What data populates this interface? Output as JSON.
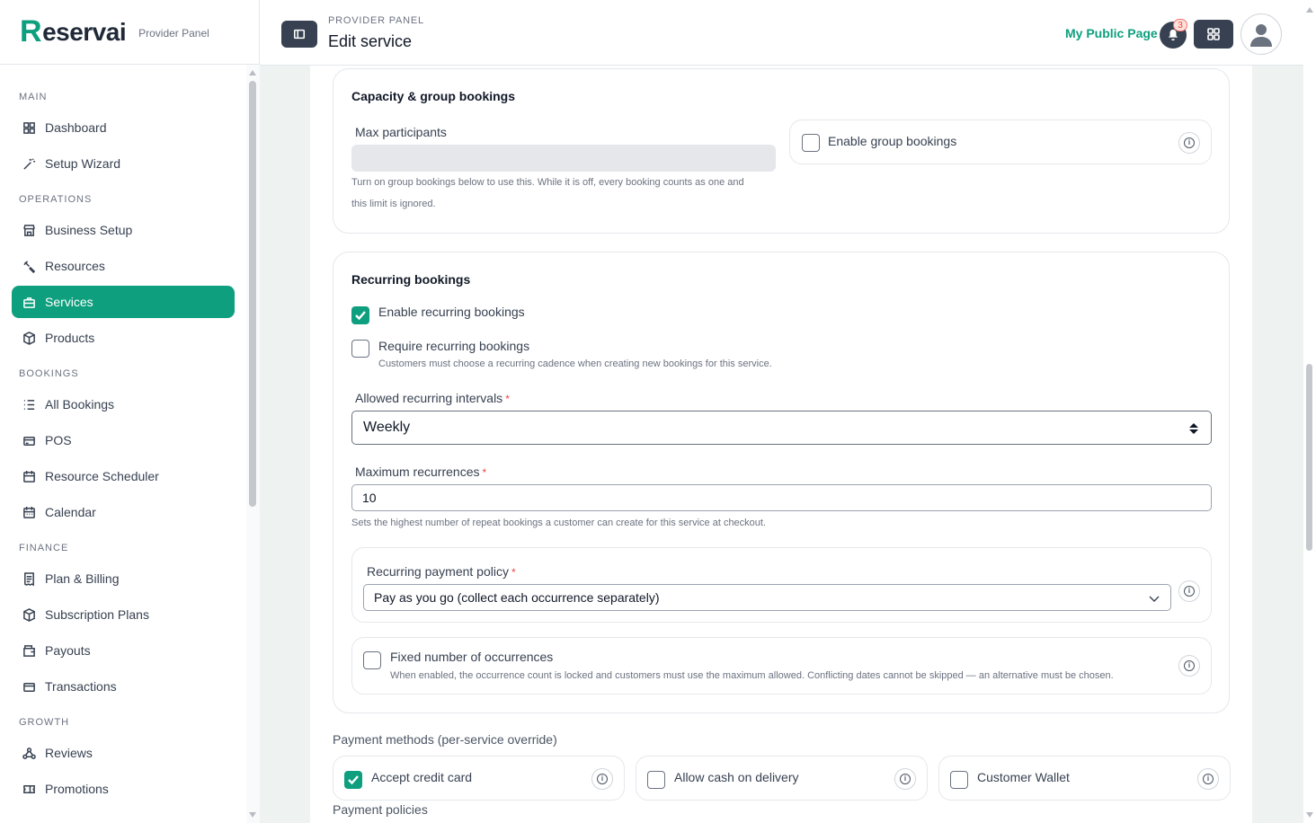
{
  "brand": {
    "name": "eservai",
    "initial": "R",
    "subtitle": "Provider Panel"
  },
  "sidebar": {
    "sections": [
      {
        "title": "MAIN",
        "items": [
          {
            "label": "Dashboard",
            "icon": "grid-icon"
          },
          {
            "label": "Setup Wizard",
            "icon": "wand-icon"
          }
        ]
      },
      {
        "title": "OPERATIONS",
        "items": [
          {
            "label": "Business Setup",
            "icon": "store-icon"
          },
          {
            "label": "Resources",
            "icon": "tools-icon"
          },
          {
            "label": "Services",
            "icon": "briefcase-icon",
            "active": true
          },
          {
            "label": "Products",
            "icon": "box-icon"
          }
        ]
      },
      {
        "title": "BOOKINGS",
        "items": [
          {
            "label": "All Bookings",
            "icon": "list-icon"
          },
          {
            "label": "POS",
            "icon": "card-icon"
          },
          {
            "label": "Resource Scheduler",
            "icon": "calendar-icon"
          },
          {
            "label": "Calendar",
            "icon": "calendar-icon"
          }
        ]
      },
      {
        "title": "FINANCE",
        "items": [
          {
            "label": "Plan & Billing",
            "icon": "receipt-icon"
          },
          {
            "label": "Subscription Plans",
            "icon": "box-icon"
          },
          {
            "label": "Payouts",
            "icon": "wallet-icon"
          },
          {
            "label": "Transactions",
            "icon": "card-icon"
          }
        ]
      },
      {
        "title": "GROWTH",
        "items": [
          {
            "label": "Reviews",
            "icon": "nodes-icon"
          },
          {
            "label": "Promotions",
            "icon": "ticket-icon"
          }
        ]
      }
    ]
  },
  "header": {
    "breadcrumb": "PROVIDER PANEL",
    "title": "Edit service",
    "public_page": "My Public Page",
    "notification_count": "3"
  },
  "capacity": {
    "title": "Capacity & group bookings",
    "max_label": "Max participants",
    "max_value": "",
    "max_help_1": "Turn on group bookings below to use this. While it is off, every booking counts as one and",
    "max_help_2": "this limit is ignored.",
    "group_label": "Enable group bookings",
    "group_checked": false
  },
  "recurring": {
    "title": "Recurring bookings",
    "enable_label": "Enable recurring bookings",
    "enable_checked": true,
    "require_label": "Require recurring bookings",
    "require_checked": false,
    "require_help": "Customers must choose a recurring cadence when creating new bookings for this service.",
    "intervals_label": "Allowed recurring intervals",
    "intervals_value": "Weekly",
    "max_rec_label": "Maximum recurrences",
    "max_rec_value": "10",
    "max_rec_help": "Sets the highest number of repeat bookings a customer can create for this service at checkout.",
    "payment_label": "Recurring payment policy",
    "payment_value": "Pay as you go (collect each occurrence separately)",
    "fixed_label": "Fixed number of occurrences",
    "fixed_checked": false,
    "fixed_help": "When enabled, the occurrence count is locked and customers must use the maximum allowed. Conflicting dates cannot be skipped — an alternative must be chosen.",
    "required_mark": "*"
  },
  "payment_methods": {
    "title": "Payment methods (per-service override)",
    "options": [
      {
        "label": "Accept credit card",
        "checked": true
      },
      {
        "label": "Allow cash on delivery",
        "checked": false
      },
      {
        "label": "Customer Wallet",
        "checked": false
      }
    ]
  },
  "payment_policies": {
    "title": "Payment policies"
  },
  "colors": {
    "accent": "#0e9f7e",
    "dark": "#374151",
    "danger": "#ef4444"
  }
}
